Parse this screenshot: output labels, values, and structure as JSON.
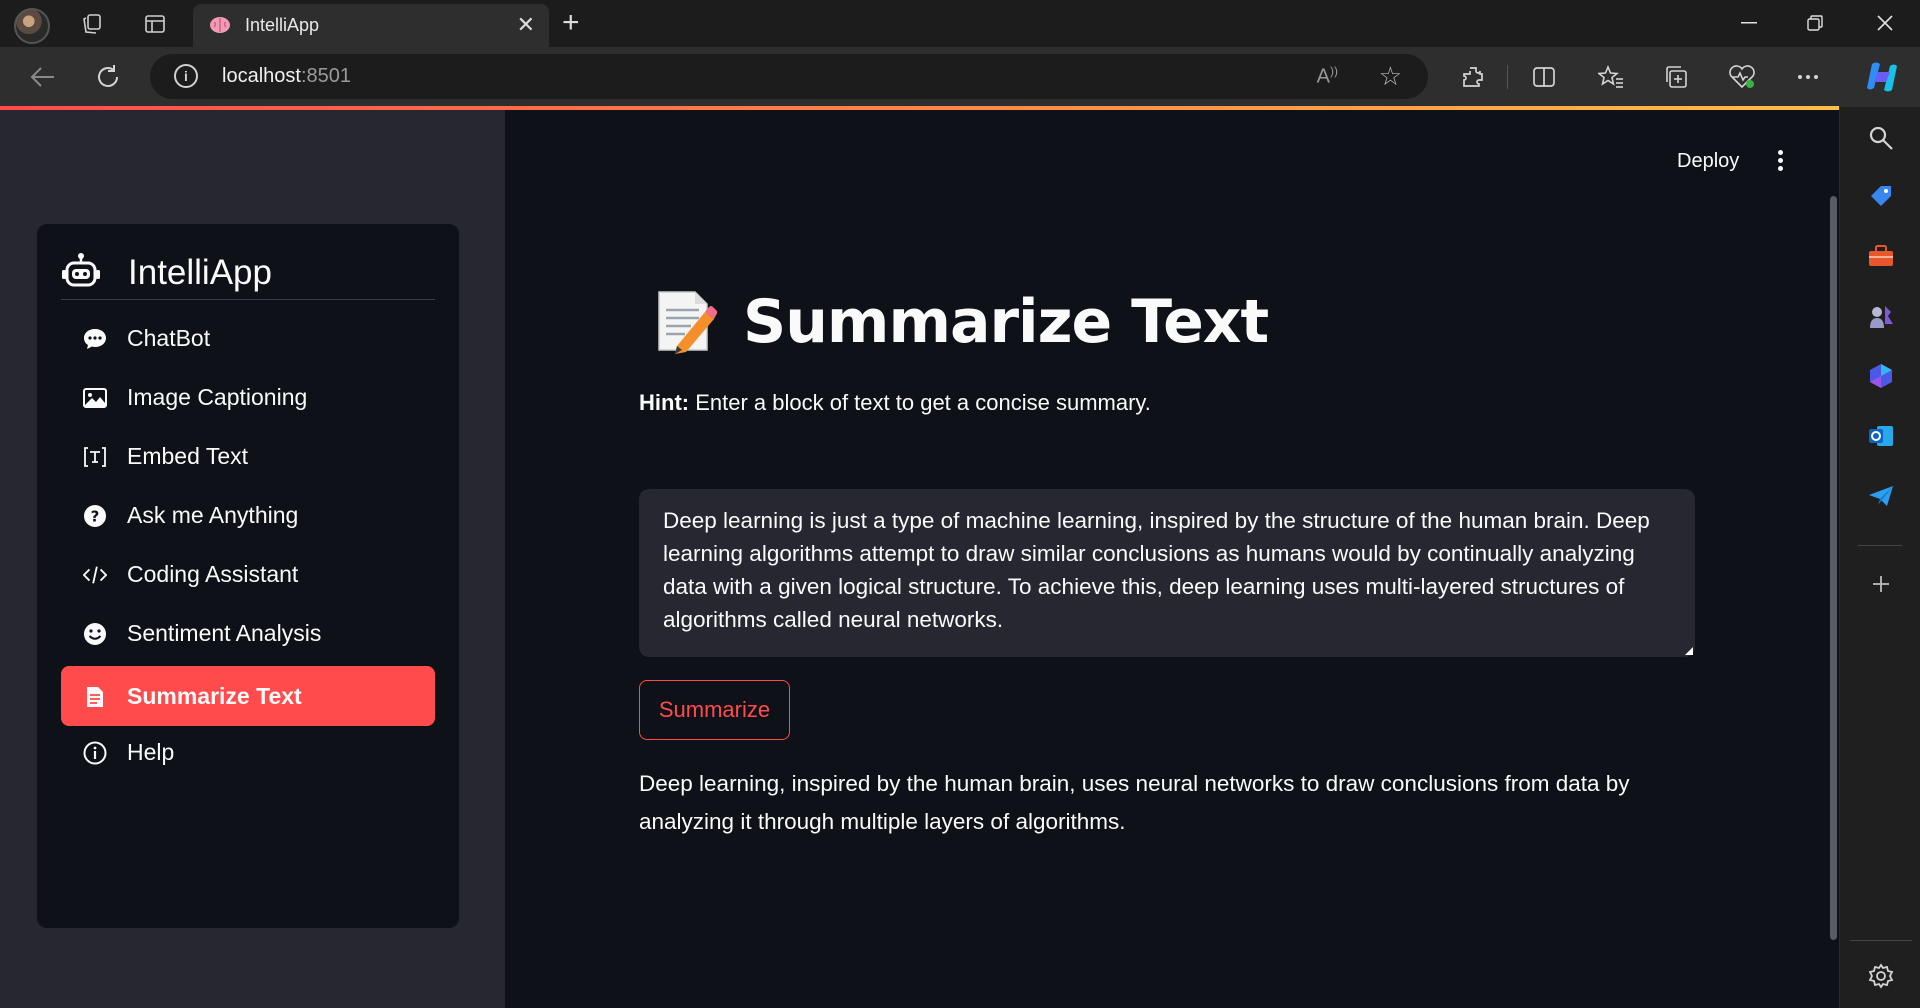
{
  "browser": {
    "tab_title": "IntelliApp",
    "url_host": "localhost",
    "url_port": ":8501"
  },
  "app": {
    "name": "IntelliApp",
    "menu": [
      {
        "label": "ChatBot",
        "icon": "chat-icon"
      },
      {
        "label": "Image Captioning",
        "icon": "image-icon"
      },
      {
        "label": "Embed Text",
        "icon": "embed-icon"
      },
      {
        "label": "Ask me Anything",
        "icon": "question-icon"
      },
      {
        "label": "Coding Assistant",
        "icon": "code-icon"
      },
      {
        "label": "Sentiment Analysis",
        "icon": "smile-icon"
      },
      {
        "label": "Summarize Text",
        "icon": "document-icon",
        "active": true
      },
      {
        "label": "Help",
        "icon": "info-icon"
      }
    ],
    "accent_color": "#ff4b4b"
  },
  "header": {
    "deploy_label": "Deploy"
  },
  "page": {
    "title": "Summarize Text",
    "hint_label": "Hint:",
    "hint_text": " Enter a block of text to get a concise summary.",
    "input_text": "Deep learning is just a type of machine learning, inspired by the structure of the human brain. Deep learning algorithms attempt to draw similar conclusions as humans would by continually analyzing data with a given logical structure. To achieve this, deep learning uses multi-layered structures of algorithms called neural networks.",
    "button_label": "Summarize",
    "result_text": "Deep learning, inspired by the human brain, uses neural networks to draw conclusions from data by analyzing it through multiple layers of algorithms."
  }
}
